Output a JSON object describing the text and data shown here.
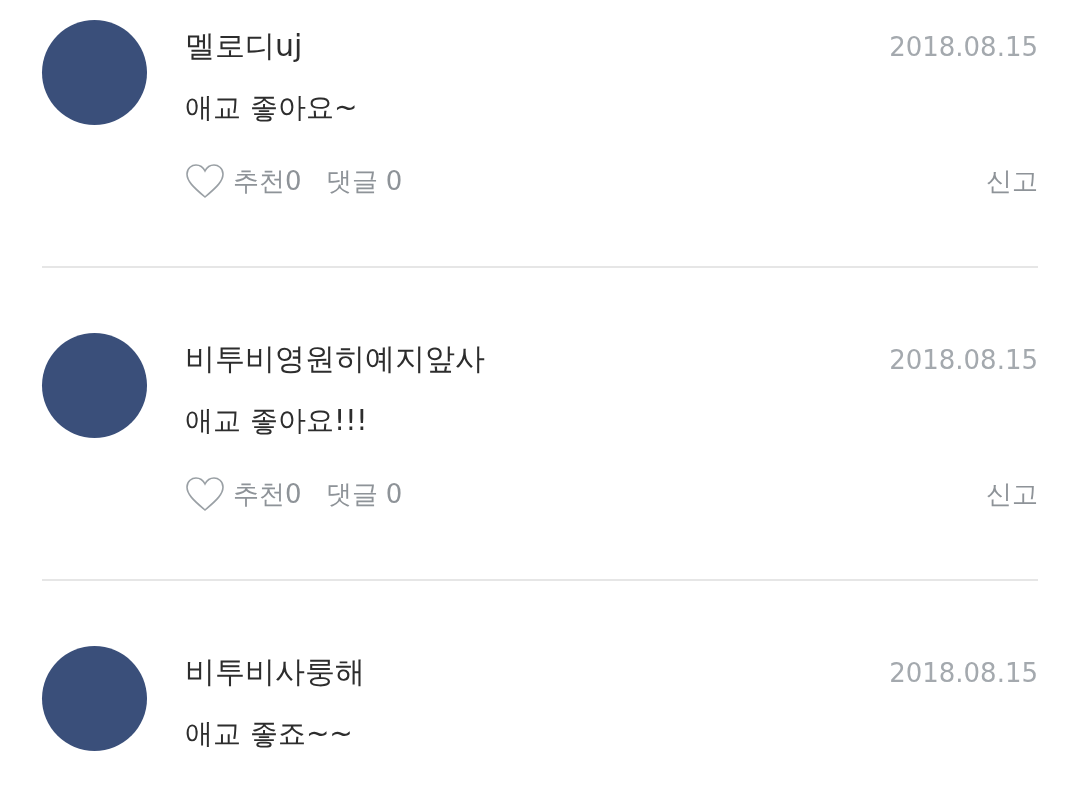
{
  "comments": [
    {
      "author": "멜로디uj",
      "date": "2018.08.15",
      "text": "애교 좋아요~",
      "actions": {
        "liked": false,
        "recommend": "추천0",
        "replies": "댓글 0",
        "report": "신고"
      }
    },
    {
      "author": "비투비영원히예지앞사",
      "date": "2018.08.15",
      "text": "애교 좋아요!!!",
      "actions": {
        "liked": false,
        "recommend": "추천0",
        "replies": "댓글 0",
        "report": "신고"
      }
    },
    {
      "author": "비투비사룽해",
      "date": "2018.08.15",
      "text": "애교 좋죠~~"
    }
  ]
}
